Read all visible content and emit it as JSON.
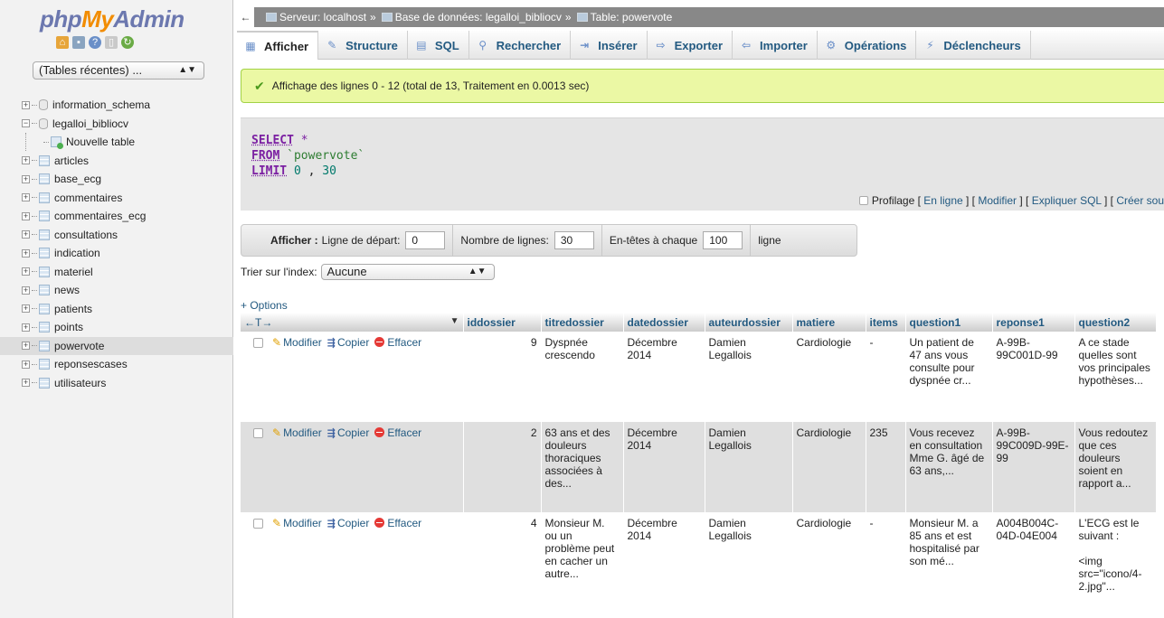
{
  "logo": {
    "php": "php",
    "my": "My",
    "admin": "Admin"
  },
  "nav_icons": [
    "home-icon",
    "exit-icon",
    "help-icon",
    "docs-icon",
    "reload-icon"
  ],
  "recent_tables": "(Tables récentes) ...",
  "tree": {
    "databases": [
      {
        "name": "information_schema",
        "expanded": false
      },
      {
        "name": "legalloi_bibliocv",
        "expanded": true
      }
    ],
    "new_table": "Nouvelle table",
    "tables": [
      "articles",
      "base_ecg",
      "commentaires",
      "commentaires_ecg",
      "consultations",
      "indication",
      "materiel",
      "news",
      "patients",
      "points",
      "powervote",
      "reponsescases",
      "utilisateurs"
    ],
    "selected_table": "powervote"
  },
  "breadcrumb": {
    "server": "Serveur: localhost",
    "database": "Base de données: legalloi_bibliocv",
    "table": "Table: powervote",
    "sep": "»"
  },
  "tabs": [
    {
      "label": "Afficher",
      "icon": "browse-icon",
      "active": true
    },
    {
      "label": "Structure",
      "icon": "structure-icon",
      "active": false
    },
    {
      "label": "SQL",
      "icon": "sql-icon",
      "active": false
    },
    {
      "label": "Rechercher",
      "icon": "search-icon",
      "active": false
    },
    {
      "label": "Insérer",
      "icon": "insert-icon",
      "active": false
    },
    {
      "label": "Exporter",
      "icon": "export-icon",
      "active": false
    },
    {
      "label": "Importer",
      "icon": "import-icon",
      "active": false
    },
    {
      "label": "Opérations",
      "icon": "operations-icon",
      "active": false
    },
    {
      "label": "Déclencheurs",
      "icon": "triggers-icon",
      "active": false
    }
  ],
  "success_message": "Affichage des lignes 0 - 12 (total de 13, Traitement en 0.0013 sec)",
  "sql": {
    "select": "SELECT",
    "star": "*",
    "from": "FROM",
    "table": "`powervote`",
    "limit": "LIMIT",
    "offset": "0",
    "comma": ",",
    "count": "30"
  },
  "sql_links": {
    "profiling": "Profilage",
    "inline": "En ligne",
    "edit": "Modifier",
    "explain": "Expliquer SQL",
    "create": "Créer sou"
  },
  "nav_form": {
    "show_label": "Afficher :",
    "start_label": "Ligne de départ:",
    "start_value": "0",
    "rows_label": "Nombre de lignes:",
    "rows_value": "30",
    "headers_label": "En-têtes à chaque",
    "headers_value": "100",
    "headers_suffix": "ligne"
  },
  "sort": {
    "label": "Trier sur l'index:",
    "value": "Aucune"
  },
  "options_link": "+ Options",
  "columns": [
    "iddossier",
    "titredossier",
    "datedossier",
    "auteurdossier",
    "matiere",
    "items",
    "question1",
    "reponse1",
    "question2"
  ],
  "row_actions": {
    "edit": "Modifier",
    "copy": "Copier",
    "delete": "Effacer"
  },
  "rows": [
    {
      "iddossier": "9",
      "titredossier": "Dyspnée crescendo",
      "datedossier": "Décembre 2014",
      "auteurdossier": "Damien Legallois",
      "matiere": "Cardiologie",
      "items": "-",
      "question1": "Un patient de 47 ans vous consulte pour dyspnée cr...",
      "reponse1": "A-99B-99C001D-99",
      "question2": "A ce stade quelles sont vos principales hypothèses..."
    },
    {
      "iddossier": "2",
      "titredossier": "63 ans et des douleurs thoraciques associées à des...",
      "datedossier": "Décembre 2014",
      "auteurdossier": "Damien Legallois",
      "matiere": "Cardiologie",
      "items": "235",
      "question1": "Vous recevez en consultation Mme G. âgé de 63 ans,...",
      "reponse1": "A-99B-99C009D-99E-99",
      "question2": "Vous redoutez que ces douleurs soient en rapport a..."
    },
    {
      "iddossier": "4",
      "titredossier": "Monsieur M. ou un problème peut en cacher un autre...",
      "datedossier": "Décembre 2014",
      "auteurdossier": "Damien Legallois",
      "matiere": "Cardiologie",
      "items": "-",
      "question1": "Monsieur M. a 85 ans et est hospitalisé par son mé...",
      "reponse1": "A004B004C-04D-04E004",
      "question2": "L'ECG est le suivant :\n\n<img src=\"icono/4-2.jpg\"..."
    }
  ]
}
